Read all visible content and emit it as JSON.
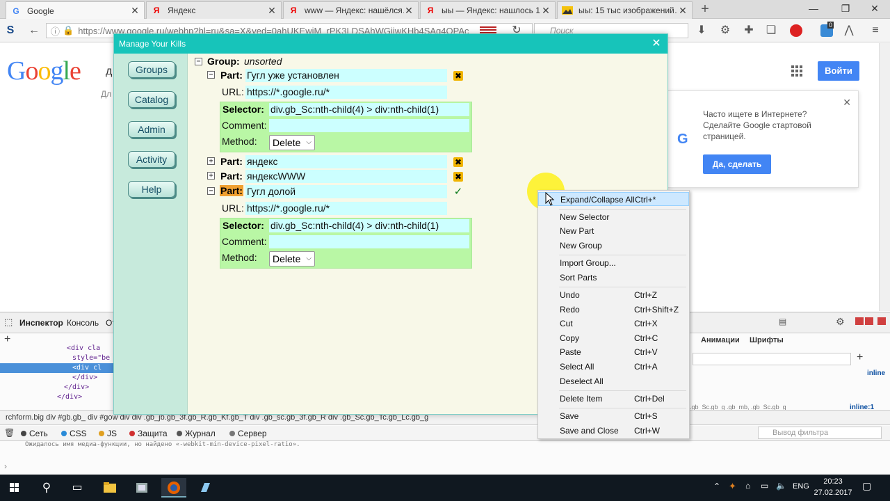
{
  "browser": {
    "tabs": [
      {
        "title": "Google",
        "favicon": "G"
      },
      {
        "title": "Яндекс",
        "favicon": "Я"
      },
      {
        "title": "www — Яндекс: нашёлся…",
        "favicon": "Я"
      },
      {
        "title": "ыы — Яндекс: нашлось 1…",
        "favicon": "Я"
      },
      {
        "title": "ыы: 15 тыс изображений…",
        "favicon": "img"
      }
    ],
    "url": "https://www.google.ru/webhp?hl=ru&sa=X&ved=0ahUKEwiM_rPK3LDSAhWGjiwKHb4SAq4QPAc",
    "search_placeholder": "Поиск",
    "addon_badge": "0"
  },
  "google": {
    "logo": "Google",
    "search_fragment": "д",
    "below_search": "Дл",
    "login": "Войти",
    "promo_text": "Часто ищете в Интернете? Сделайте Google стартовой страницей.",
    "promo_button": "Да, сделать"
  },
  "dialog": {
    "title": "Manage Your Kills",
    "nav": [
      "Groups",
      "Catalog",
      "Admin",
      "Activity",
      "Help"
    ],
    "group_label": "Group:",
    "group_name": "unsorted",
    "part_label": "Part:",
    "url_label": "URL:",
    "selector_label": "Selector:",
    "comment_label": "Comment:",
    "method_label": "Method:",
    "parts": [
      {
        "name": "Гугл уже установлен",
        "url": "https://*.google.ru/*",
        "selector": "div.gb_Sc:nth-child(4) > div:nth-child(1)",
        "comment": "",
        "method": "Delete"
      },
      {
        "name": "яндекс"
      },
      {
        "name": "яндексWWW"
      },
      {
        "name": "Гугл долой",
        "url": "https://*.google.ru/*",
        "selector": "div.gb_Sc:nth-child(4) > div:nth-child(1)",
        "comment": "",
        "method": "Delete"
      }
    ]
  },
  "context_menu": [
    {
      "label": "Expand/Collapse All",
      "shortcut": "Ctrl+*"
    },
    {
      "label": "New Selector",
      "shortcut": ""
    },
    {
      "label": "New Part",
      "shortcut": ""
    },
    {
      "label": "New Group",
      "shortcut": ""
    },
    {
      "label": "Import Group...",
      "shortcut": ""
    },
    {
      "label": "Sort Parts",
      "shortcut": ""
    },
    {
      "label": "Undo",
      "shortcut": "Ctrl+Z"
    },
    {
      "label": "Redo",
      "shortcut": "Ctrl+Shift+Z"
    },
    {
      "label": "Cut",
      "shortcut": "Ctrl+X"
    },
    {
      "label": "Copy",
      "shortcut": "Ctrl+C"
    },
    {
      "label": "Paste",
      "shortcut": "Ctrl+V"
    },
    {
      "label": "Select All",
      "shortcut": "Ctrl+A"
    },
    {
      "label": "Deselect All",
      "shortcut": ""
    },
    {
      "label": "Delete Item",
      "shortcut": "Ctrl+Del"
    },
    {
      "label": "Save",
      "shortcut": "Ctrl+S"
    },
    {
      "label": "Save and Close",
      "shortcut": "Ctrl+W"
    }
  ],
  "devtools": {
    "tabs": [
      "Инспектор",
      "Консоль",
      "От"
    ],
    "right_tabs": [
      "Анимации",
      "Шрифты"
    ],
    "tree": [
      "<div cla",
      "style=\"be",
      "<div cl",
      "</div>",
      "</div>",
      "</div>"
    ],
    "crumbs": "rchform.big    div #gb.gb_    div #gow    div    div .gb_jb.gb_3f.gb_R.gb_Kf.gb_T    div .gb_sc.gb_3f.gb_R    div .gb_Sc.gb_Tc.gb_Lc.gb_g",
    "console_filters": [
      "Сеть",
      "CSS",
      "JS",
      "Защита",
      "Журнал",
      "Сервер"
    ],
    "filter_placeholder": "Вывод фильтра",
    "message": "Ожидалось имя медиа-функции, но найдено «-webkit-min-device-pixel-ratio».",
    "rule_hint": ".gb_Sc.gb_g .gb_mb, .gb_Sc.gb_g",
    "inline1": "inline",
    "inline2": "inline:1"
  },
  "taskbar": {
    "lang": "ENG",
    "time": "20:23",
    "date": "27.02.2017"
  },
  "colors": {
    "dialog_title": "#17c4ba",
    "sidebar": "#c7eadc",
    "value_bg": "#ccffff",
    "selector_bg": "#b9f7a5",
    "highlight_part": "#f0a030"
  }
}
